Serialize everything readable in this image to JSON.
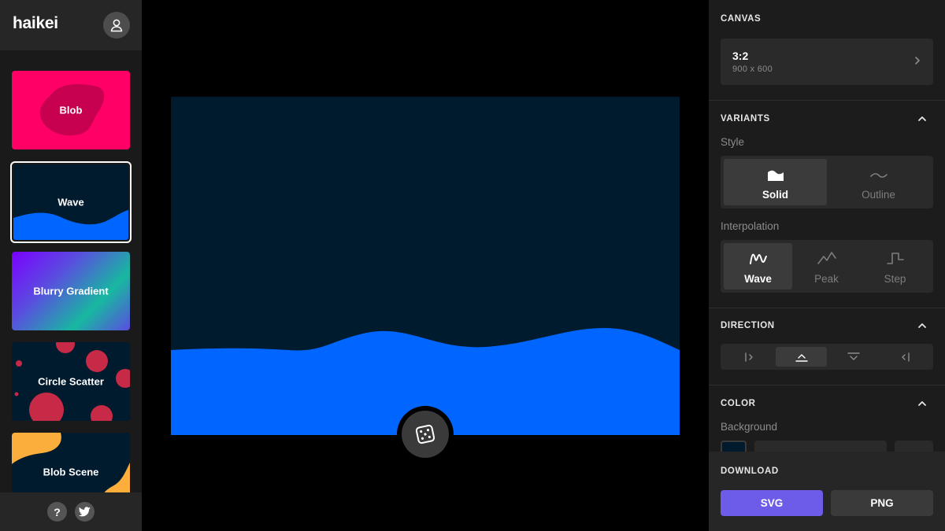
{
  "app": {
    "logo_text": "haikei"
  },
  "sidebar": {
    "generators": [
      {
        "label": "Blob"
      },
      {
        "label": "Wave"
      },
      {
        "label": "Blurry Gradient"
      },
      {
        "label": "Circle Scatter"
      },
      {
        "label": "Blob Scene"
      }
    ],
    "footer": {
      "help_label": "?"
    }
  },
  "panel": {
    "canvas": {
      "title": "CANVAS",
      "ratio": "3:2",
      "size": "900 x 600"
    },
    "variants": {
      "title": "VARIANTS",
      "style_label": "Style",
      "style_options": [
        "Solid",
        "Outline"
      ],
      "style_selected": "Solid",
      "interpolation_label": "Interpolation",
      "interpolation_options": [
        "Wave",
        "Peak",
        "Step"
      ],
      "interpolation_selected": "Wave"
    },
    "direction": {
      "title": "DIRECTION",
      "selected": "up"
    },
    "color": {
      "title": "COLOR",
      "background_label": "Background",
      "background_value": "#001a2e"
    },
    "download": {
      "title": "DOWNLOAD",
      "svg_label": "SVG",
      "png_label": "PNG"
    }
  },
  "colors": {
    "accent": "#6c5ce7",
    "wave_fill": "#0066ff",
    "canvas_background": "#001a2e",
    "blob_card": "#ff0066",
    "circle_color": "#c62a47",
    "blob_scene_yellow": "#fbae3c"
  }
}
